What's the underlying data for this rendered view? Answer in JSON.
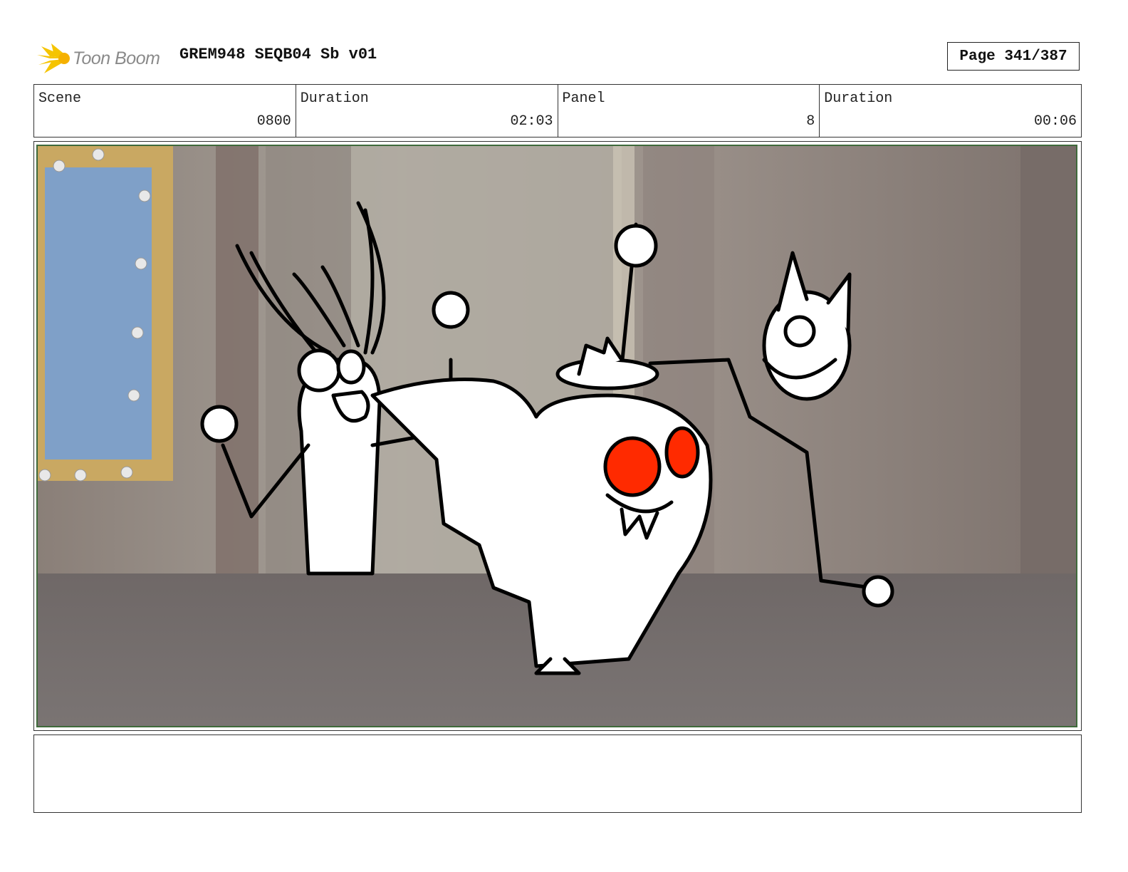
{
  "header": {
    "logo_text": "Toon Boom",
    "document_title": "GREM948 SEQB04 Sb v01",
    "page_label": "Page 341/387"
  },
  "info": {
    "scene_label": "Scene",
    "scene_value": "0800",
    "scene_duration_label": "Duration",
    "scene_duration_value": "02:03",
    "panel_label": "Panel",
    "panel_value": "8",
    "panel_duration_label": "Duration",
    "panel_duration_value": "00:06"
  },
  "notes": {
    "text": ""
  },
  "colors": {
    "logo_yellow": "#f5c400",
    "frame_green": "#3f6a3b",
    "eye_red": "#ff2a00",
    "mirror_blue": "#7fa0c8"
  }
}
